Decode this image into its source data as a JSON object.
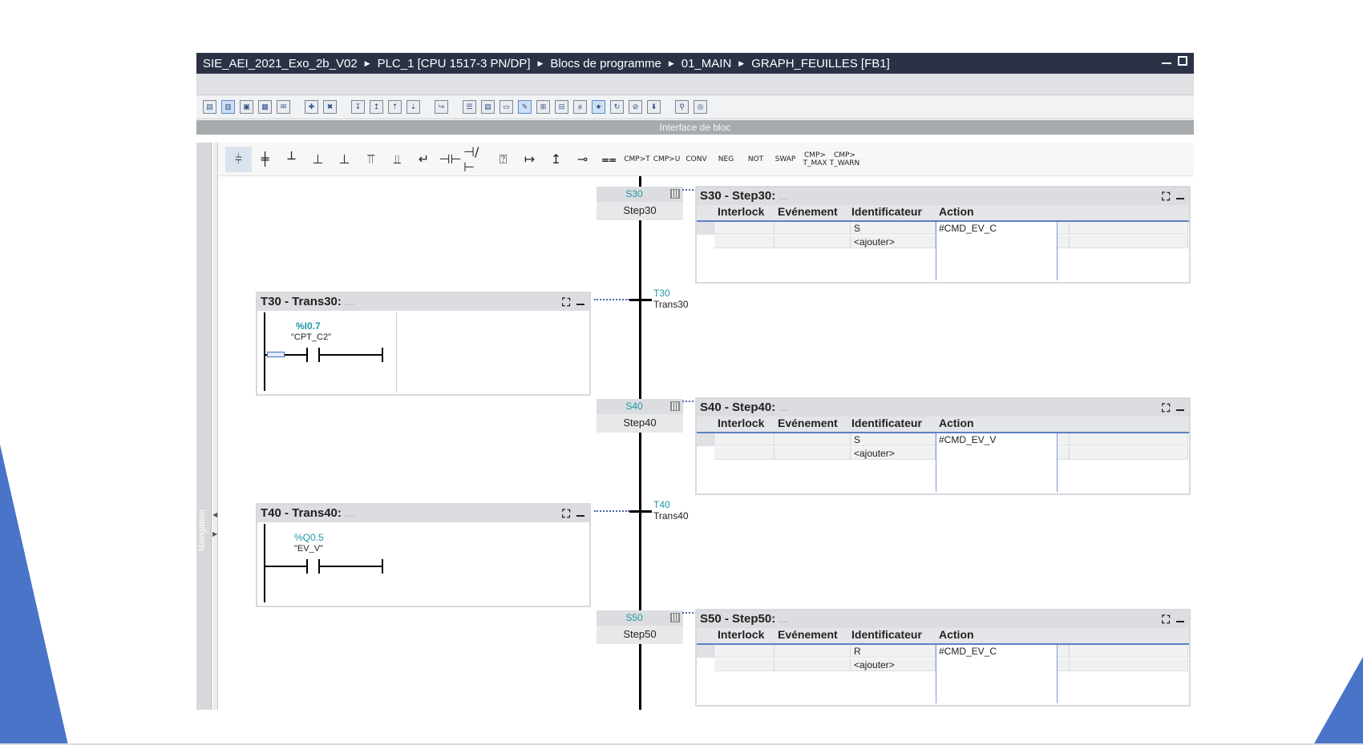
{
  "titlebar": {
    "crumbs": [
      "SIE_AEI_2021_Exo_2b_V02",
      "PLC_1 [CPU 1517-3 PN/DP]",
      "Blocs de programme",
      "01_MAIN",
      "GRAPH_FEUILLES [FB1]"
    ],
    "sep": "▶"
  },
  "interface_label": "Interface de bloc",
  "navigation_label": "Navigation",
  "toolbar_text": {
    "cmp_t": "CMP>T",
    "cmp_u": "CMP>U",
    "conv": "CONV",
    "neg": "NEG",
    "not": "NOT",
    "swap": "SWAP",
    "cmp_tmax": "CMP> T_MAX",
    "cmp_twarn": "CMP> T_WARN"
  },
  "columns": {
    "interlock": "Interlock",
    "evenement": "Evénement",
    "identificateur": "Identificateur",
    "action": "Action"
  },
  "add_label": "<ajouter>",
  "steps": [
    {
      "num": "S30",
      "name": "Step30",
      "title": "S30 - Step30:",
      "sub": "....",
      "qualifier": "S",
      "action": "#CMD_EV_C"
    },
    {
      "num": "S40",
      "name": "Step40",
      "title": "S40 - Step40:",
      "sub": "....",
      "qualifier": "S",
      "action": "#CMD_EV_V"
    },
    {
      "num": "S50",
      "name": "Step50",
      "title": "S50 - Step50:",
      "sub": "....",
      "qualifier": "R",
      "action": "#CMD_EV_C"
    }
  ],
  "transitions": [
    {
      "num": "T30",
      "name": "Trans30",
      "title": "T30 - Trans30:",
      "sub": "....",
      "address": "%I0.7",
      "symbol": "\"CPT_C2\""
    },
    {
      "num": "T40",
      "name": "Trans40",
      "title": "T40 - Trans40:",
      "sub": "....",
      "address": "%Q0.5",
      "symbol": "\"EV_V\""
    }
  ]
}
